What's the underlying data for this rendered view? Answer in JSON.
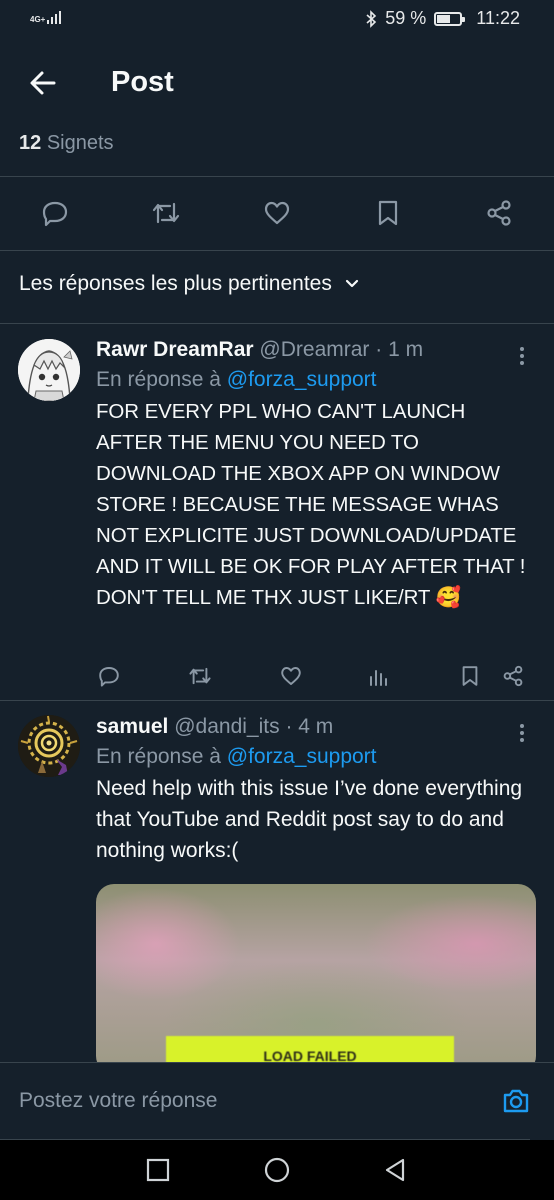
{
  "status_bar": {
    "network": "4G+",
    "battery_percent_label": "59 %",
    "battery_level": 0.59,
    "time": "11:22"
  },
  "header": {
    "title": "Post",
    "back_icon": "arrow-left-icon"
  },
  "stats": {
    "bookmark_count": "12",
    "bookmark_label": "Signets"
  },
  "post_actions": [
    "reply-icon",
    "retweet-icon",
    "like-icon",
    "bookmark-icon",
    "share-icon"
  ],
  "sort": {
    "label": "Les réponses les plus pertinentes",
    "icon": "chevron-down-icon"
  },
  "replies": [
    {
      "name": "Rawr DreamRar",
      "handle": "@Dreamrar",
      "separator": "·",
      "time": "1 m",
      "in_reply_prefix": "En réponse à",
      "in_reply_mention": "@forza_support",
      "text": "FOR EVERY PPL WHO CAN'T LAUNCH AFTER THE MENU YOU NEED TO DOWNLOAD THE XBOX APP ON WINDOW STORE ! BECAUSE THE MESSAGE WHAS NOT EXPLICITE JUST DOWNLOAD/UPDATE AND IT WILL BE OK FOR PLAY AFTER THAT ! DON'T TELL ME THX JUST LIKE/RT 🥰"
    },
    {
      "name": "samuel",
      "handle": "@dandi_its",
      "separator": "·",
      "time": "4 m",
      "in_reply_prefix": "En réponse à",
      "in_reply_mention": "@forza_support",
      "text": "Need help with this issue I’ve done everything that YouTube and Reddit post say to do and nothing works:(",
      "media_caption": "LOAD FAILED"
    }
  ],
  "compose": {
    "placeholder": "Postez votre réponse",
    "camera_icon": "camera-icon"
  },
  "colors": {
    "background": "#15202b",
    "accent": "#1d9bf0",
    "secondary_text": "#8b98a5",
    "divider": "#38444d"
  }
}
